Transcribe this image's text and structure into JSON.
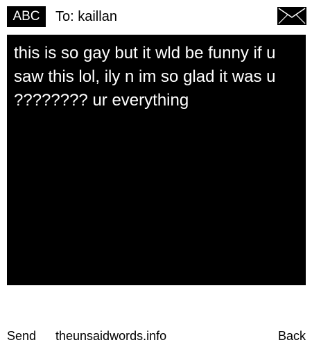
{
  "header": {
    "mode_label": "ABC",
    "to_text": "To: kaillan",
    "icon": "envelope-icon"
  },
  "message": {
    "body": "this is so gay but it wld be funny if u saw this lol, ily n im so glad it was u ???????? ur everything"
  },
  "footer": {
    "send_label": "Send",
    "site_label": "theunsaidwords.info",
    "back_label": "Back"
  },
  "colors": {
    "background": "#ffffff",
    "message_bg": "#000000",
    "message_text": "#ffffff",
    "text": "#000000"
  }
}
